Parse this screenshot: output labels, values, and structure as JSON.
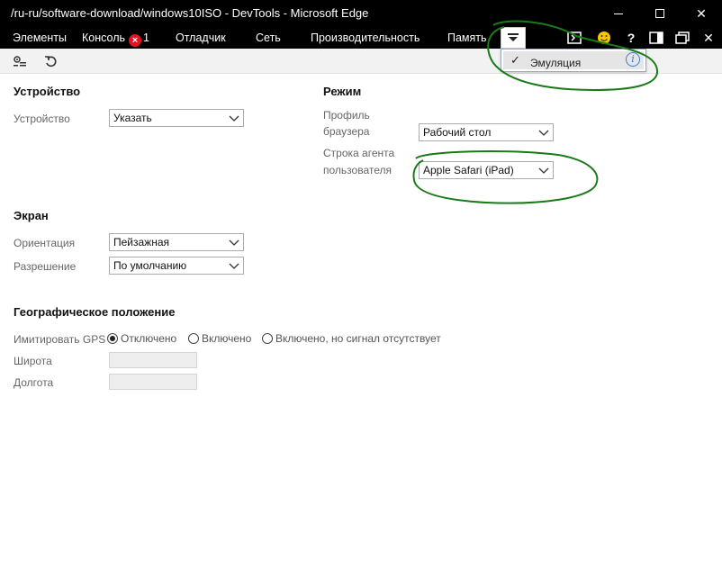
{
  "window": {
    "title": "/ru-ru/software-download/windows10ISO - DevTools - Microsoft Edge",
    "minimize_glyph": "—",
    "close_glyph": "✕"
  },
  "tabs": [
    {
      "label": "Элементы"
    },
    {
      "label": "Консоль",
      "error_count": "1"
    },
    {
      "label": "Отладчик"
    },
    {
      "label": "Сеть"
    },
    {
      "label": "Производительность"
    },
    {
      "label": "Память"
    }
  ],
  "tabbar_icons": [
    "overflow-menu-icon",
    "console-icon",
    "feedback-smiley-icon",
    "help-icon",
    "dock-icon",
    "undock-icon",
    "close-icon"
  ],
  "toolbar_icons": [
    "settings-icon",
    "reset-icon"
  ],
  "dropdown": {
    "checked": "✓",
    "item_label": "Эмуляция",
    "info_glyph": "i"
  },
  "device": {
    "title": "Устройство",
    "device_label": "Устройство",
    "device_value": "Указать"
  },
  "mode": {
    "title": "Режим",
    "profile_label_1": "Профиль",
    "profile_label_2": "браузера",
    "profile_value": "Рабочий стол",
    "ua_label_1": "Строка агента",
    "ua_label_2": "пользователя",
    "ua_value": "Apple Safari (iPad)"
  },
  "screen": {
    "title": "Экран",
    "orientation_label": "Ориентация",
    "orientation_value": "Пейзажная",
    "resolution_label": "Разрешение",
    "resolution_value": "По умолчанию"
  },
  "geo": {
    "title": "Географическое положение",
    "gps_label": "Имитировать GPS",
    "options": [
      {
        "label": "Отключено",
        "selected": true
      },
      {
        "label": "Включено",
        "selected": false
      },
      {
        "label": "Включено, но сигнал отсутствует",
        "selected": false
      }
    ],
    "latitude_label": "Широта",
    "latitude_value": "",
    "longitude_label": "Долгота",
    "longitude_value": ""
  },
  "colors": {
    "titlebar": "#000000",
    "annotation": "#1a7a1a",
    "error_badge": "#e81123",
    "info_icon": "#3b7dd8"
  }
}
